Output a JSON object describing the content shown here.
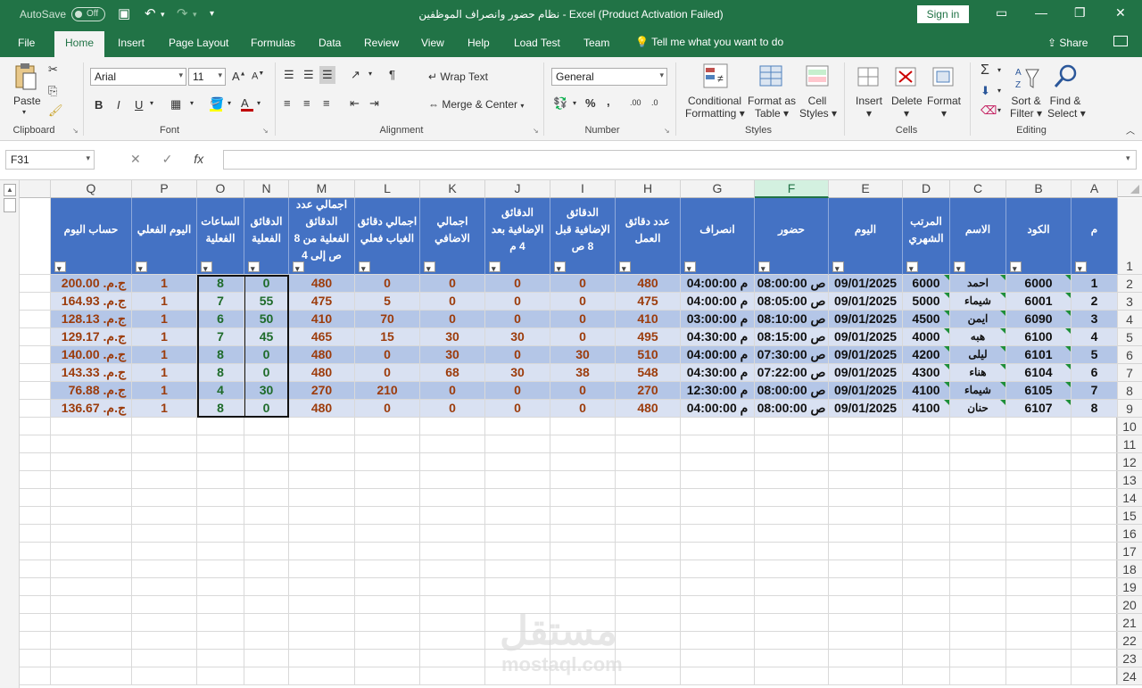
{
  "titlebar": {
    "autosave_label": "AutoSave",
    "autosave_state": "Off",
    "title": "نظام حضور وانصراف الموظفين  -  Excel (Product Activation Failed)",
    "signin": "Sign in"
  },
  "tabs": [
    "File",
    "Home",
    "Insert",
    "Page Layout",
    "Formulas",
    "Data",
    "Review",
    "View",
    "Help",
    "Load Test",
    "Team"
  ],
  "tellme": "Tell me what you want to do",
  "share": "Share",
  "ribbon": {
    "clipboard": {
      "paste": "Paste",
      "label": "Clipboard"
    },
    "font": {
      "name": "Arial",
      "size": "11",
      "label": "Font"
    },
    "alignment": {
      "wrap": "Wrap Text",
      "merge": "Merge & Center",
      "label": "Alignment"
    },
    "number": {
      "format": "General",
      "label": "Number"
    },
    "styles": {
      "conditional": "Conditional",
      "conditional2": "Formatting",
      "format_as": "Format as",
      "format_as2": "Table",
      "cell": "Cell",
      "cell2": "Styles",
      "label": "Styles"
    },
    "cells": {
      "insert": "Insert",
      "delete": "Delete",
      "format": "Format",
      "label": "Cells"
    },
    "editing": {
      "sort": "Sort &",
      "sort2": "Filter",
      "find": "Find &",
      "find2": "Select",
      "label": "Editing"
    }
  },
  "formula_bar": {
    "name_box": "F31",
    "fx": "fx",
    "value": ""
  },
  "columns": [
    "Q",
    "P",
    "O",
    "N",
    "M",
    "L",
    "K",
    "J",
    "I",
    "H",
    "G",
    "F",
    "E",
    "D",
    "C",
    "B",
    "A"
  ],
  "selected_column": "F",
  "row_numbers": [
    "1",
    "2",
    "3",
    "4",
    "5",
    "6",
    "7",
    "8",
    "9",
    "10",
    "11",
    "12",
    "13",
    "14",
    "15",
    "16",
    "17",
    "18",
    "19",
    "20",
    "21",
    "22",
    "23",
    "24"
  ],
  "headers": {
    "Q": "حساب اليوم",
    "P": "اليوم الفعلي",
    "O": "الساعات الفعلية",
    "N": "الدقائق الفعلية",
    "M": "اجمالي عدد الدقائق الفعلية من 8 ص إلى 4",
    "L": "اجمالي دقائق الغياب فعلي",
    "K": "اجمالي الاضافي",
    "J": "الدقائق الإضافية بعد 4 م",
    "I": "الدقائق الإضافية قبل 8 ص",
    "H": "عدد دقائق العمل",
    "G": "انصراف",
    "F": "حضور",
    "E": "اليوم",
    "D": "المرتب الشهري",
    "C": "الاسم",
    "B": "الكود",
    "A": "م"
  },
  "rows": [
    {
      "A": "1",
      "B": "6000",
      "C": "احمد",
      "D": "6000",
      "E": "09/01/2025",
      "F": "ص 08:00:00",
      "G": "م 04:00:00",
      "H": "480",
      "I": "0",
      "J": "0",
      "K": "0",
      "L": "0",
      "M": "480",
      "N": "0",
      "O": "8",
      "P": "1",
      "Q": "ج.م. 200.00"
    },
    {
      "A": "2",
      "B": "6001",
      "C": "شيماء",
      "D": "5000",
      "E": "09/01/2025",
      "F": "ص 08:05:00",
      "G": "م 04:00:00",
      "H": "475",
      "I": "0",
      "J": "0",
      "K": "0",
      "L": "5",
      "M": "475",
      "N": "55",
      "O": "7",
      "P": "1",
      "Q": "ج.م. 164.93"
    },
    {
      "A": "3",
      "B": "6090",
      "C": "ايمن",
      "D": "4500",
      "E": "09/01/2025",
      "F": "ص 08:10:00",
      "G": "م 03:00:00",
      "H": "410",
      "I": "0",
      "J": "0",
      "K": "0",
      "L": "70",
      "M": "410",
      "N": "50",
      "O": "6",
      "P": "1",
      "Q": "ج.م. 128.13"
    },
    {
      "A": "4",
      "B": "6100",
      "C": "هبه",
      "D": "4000",
      "E": "09/01/2025",
      "F": "ص 08:15:00",
      "G": "م 04:30:00",
      "H": "495",
      "I": "0",
      "J": "30",
      "K": "30",
      "L": "15",
      "M": "465",
      "N": "45",
      "O": "7",
      "P": "1",
      "Q": "ج.م. 129.17"
    },
    {
      "A": "5",
      "B": "6101",
      "C": "ليلى",
      "D": "4200",
      "E": "09/01/2025",
      "F": "ص 07:30:00",
      "G": "م 04:00:00",
      "H": "510",
      "I": "30",
      "J": "0",
      "K": "30",
      "L": "0",
      "M": "480",
      "N": "0",
      "O": "8",
      "P": "1",
      "Q": "ج.م. 140.00"
    },
    {
      "A": "6",
      "B": "6104",
      "C": "هناء",
      "D": "4300",
      "E": "09/01/2025",
      "F": "ص 07:22:00",
      "G": "م 04:30:00",
      "H": "548",
      "I": "38",
      "J": "30",
      "K": "68",
      "L": "0",
      "M": "480",
      "N": "0",
      "O": "8",
      "P": "1",
      "Q": "ج.م. 143.33"
    },
    {
      "A": "7",
      "B": "6105",
      "C": "شيماء",
      "D": "4100",
      "E": "09/01/2025",
      "F": "ص 08:00:00",
      "G": "م 12:30:00",
      "H": "270",
      "I": "0",
      "J": "0",
      "K": "0",
      "L": "210",
      "M": "270",
      "N": "30",
      "O": "4",
      "P": "1",
      "Q": "ج.م. 76.88"
    },
    {
      "A": "8",
      "B": "6107",
      "C": "حنان",
      "D": "4100",
      "E": "09/01/2025",
      "F": "ص 08:00:00",
      "G": "م 04:00:00",
      "H": "480",
      "I": "0",
      "J": "0",
      "K": "0",
      "L": "0",
      "M": "480",
      "N": "0",
      "O": "8",
      "P": "1",
      "Q": "ج.م. 136.67"
    }
  ],
  "watermark": {
    "arabic": "مستقل",
    "latin": "mostaql.com"
  },
  "colors": {
    "excel_green": "#217346",
    "header_blue": "#4472c4",
    "band_dark": "#b4c6e7",
    "band_light": "#d9e1f2",
    "value_brown": "#9c3c0c"
  }
}
